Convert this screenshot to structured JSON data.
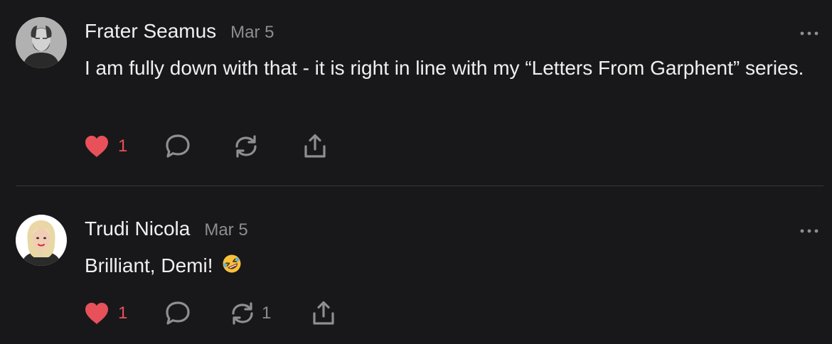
{
  "comments": [
    {
      "author": "Frater Seamus",
      "date": "Mar 5",
      "text": "I am fully down with that - it is right in line with my “Letters From Garphent” series.",
      "likes": "1",
      "restacks": "",
      "liked": true
    },
    {
      "author": "Trudi Nicola",
      "date": "Mar 5",
      "text": "Brilliant, Demi!",
      "emoji": "rolling-on-floor-laughing",
      "likes": "1",
      "restacks": "1",
      "liked": true
    }
  ],
  "icons": {
    "like": "heart-icon",
    "reply": "comment-bubble-icon",
    "restack": "restack-arrows-icon",
    "share": "share-upload-icon",
    "more": "more-dots-icon"
  },
  "colors": {
    "background": "#18181a",
    "heart": "#e8515a",
    "muted": "#8d8d92",
    "icon": "#8e8e93"
  }
}
